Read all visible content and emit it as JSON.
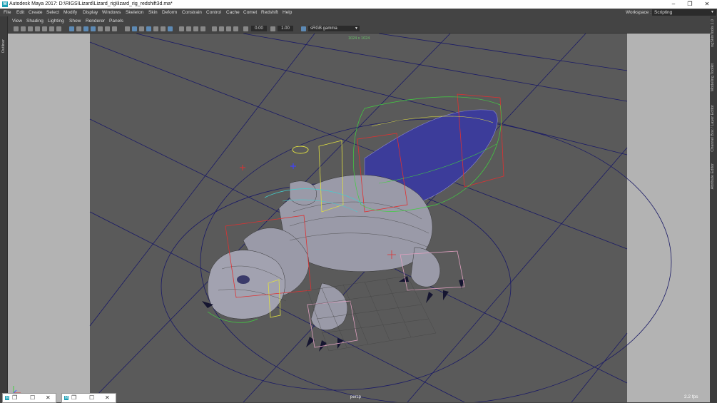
{
  "window": {
    "app_icon_letter": "M",
    "title": "Autodesk Maya 2017: D:\\RIGS\\Lizard\\Lizard_rig\\lizard_rig_redshift3d.ma*",
    "controls": {
      "minimize": "–",
      "restore": "❐",
      "close": "✕"
    }
  },
  "menubar": {
    "items": [
      "File",
      "Edit",
      "Create",
      "Select",
      "Modify",
      "Display",
      "Windows",
      "Skeleton",
      "Skin",
      "Deform",
      "Constrain",
      "Control",
      "Cache",
      "Comet",
      "Redshift",
      "Help"
    ],
    "workspace_label": "Workspace :",
    "workspace_value": "Scripting"
  },
  "left_strip": {
    "outliner_label": "Outliner"
  },
  "right_strip": {
    "tabs": [
      "ngSkinTools 1.0",
      "Modeling Toolkit",
      "Channel Box / Layer Editor",
      "Attribute Editor"
    ]
  },
  "panel_menu": {
    "items": [
      "View",
      "Shading",
      "Lighting",
      "Show",
      "Renderer",
      "Panels"
    ]
  },
  "toolbar": {
    "exposure": "0.00",
    "gamma": "1.00",
    "color_space": "sRGB gamma"
  },
  "viewport": {
    "resolution_gate": "1024 x 1024",
    "camera": "persp",
    "fps": "2.2 fps",
    "gate_mask_color": "#b3b3b3",
    "background_color": "#5a5a5a",
    "grid_color": "#1a1a66"
  },
  "taskbar": {
    "windows": [
      {
        "icon": "M",
        "restore": "❐",
        "maximize": "☐",
        "close": "✕"
      },
      {
        "icon": "M",
        "restore": "❐",
        "maximize": "☐",
        "close": "✕"
      }
    ]
  }
}
